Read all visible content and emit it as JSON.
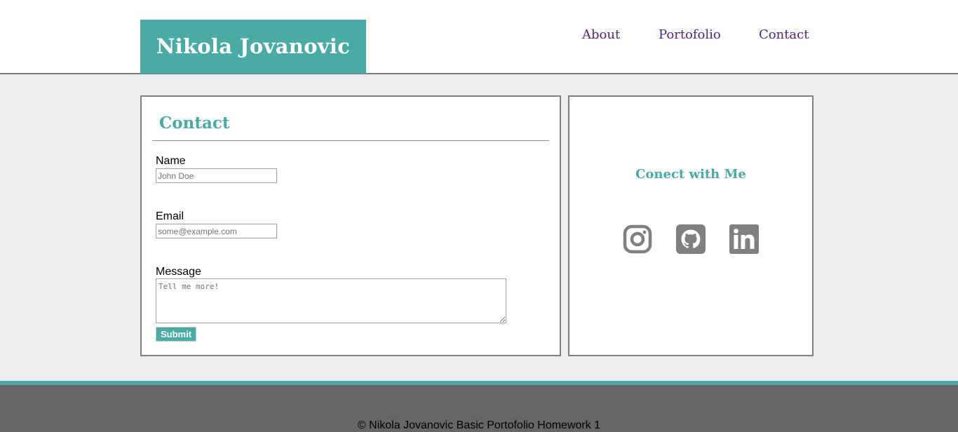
{
  "header": {
    "brand": "Nikola Jovanovic",
    "nav": [
      {
        "label": "About"
      },
      {
        "label": "Portofolio"
      },
      {
        "label": "Contact"
      }
    ]
  },
  "contact": {
    "title": "Contact",
    "name_label": "Name",
    "name_placeholder": "John Doe",
    "email_label": "Email",
    "email_placeholder": "some@example.com",
    "message_label": "Message",
    "message_placeholder": "Tell me more!",
    "submit_label": "Submit"
  },
  "connect": {
    "title": "Conect with Me",
    "icons": [
      "instagram-icon",
      "github-icon",
      "linkedin-icon"
    ]
  },
  "footer": {
    "text": "© Nikola Jovanovic Basic Portofolio Homework 1"
  },
  "colors": {
    "accent": "#4aaaa5",
    "nav_link": "#4b2a7e",
    "background": "#ededed",
    "footer": "#666666",
    "icon": "#808080"
  }
}
